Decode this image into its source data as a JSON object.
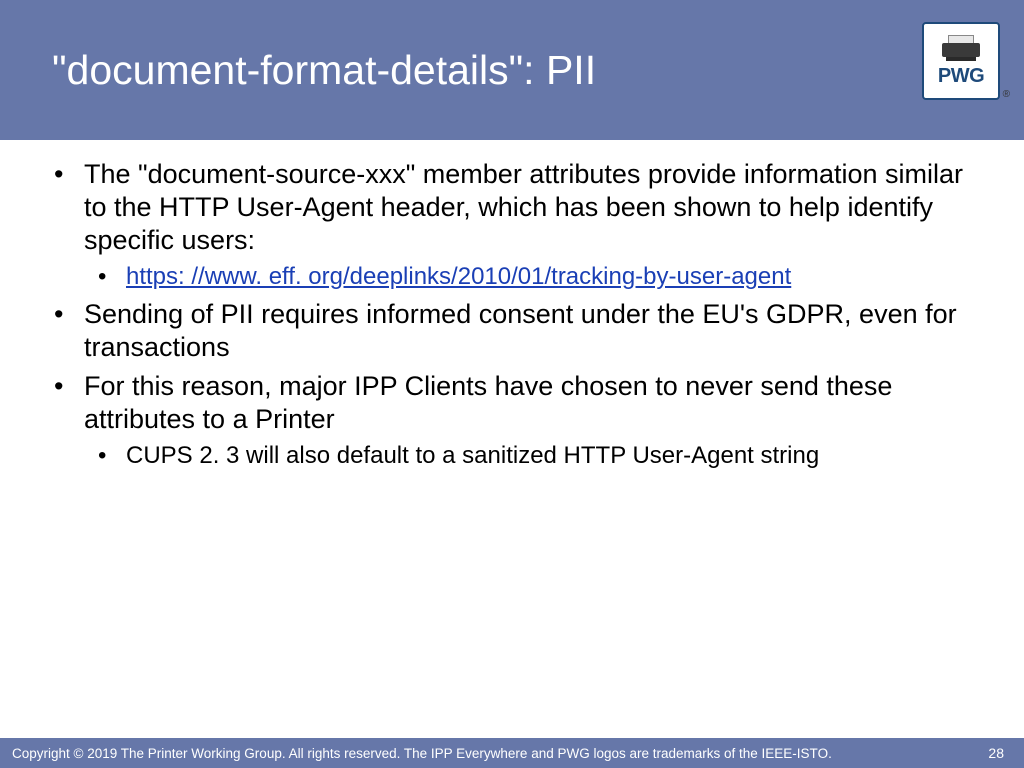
{
  "header": {
    "title": "\"document-format-details\": PII",
    "logo_text": "PWG",
    "logo_reg": "®"
  },
  "bullets": {
    "b1": "The \"document-source-xxx\" member attributes provide information similar to the HTTP User-Agent header, which has been shown to help identify specific users:",
    "b1_link": "https: //www. eff. org/deeplinks/2010/01/tracking-by-user-agent",
    "b2": "Sending of PII requires informed consent under the EU's GDPR, even for transactions",
    "b3": "For this reason, major IPP Clients have chosen to never send these attributes to a Printer",
    "b3_sub": "CUPS 2. 3 will also default to a sanitized HTTP User-Agent string"
  },
  "footer": {
    "copyright": "Copyright © 2019 The Printer Working Group. All rights reserved. The IPP Everywhere and PWG logos are trademarks of the IEEE-ISTO.",
    "page": "28"
  }
}
